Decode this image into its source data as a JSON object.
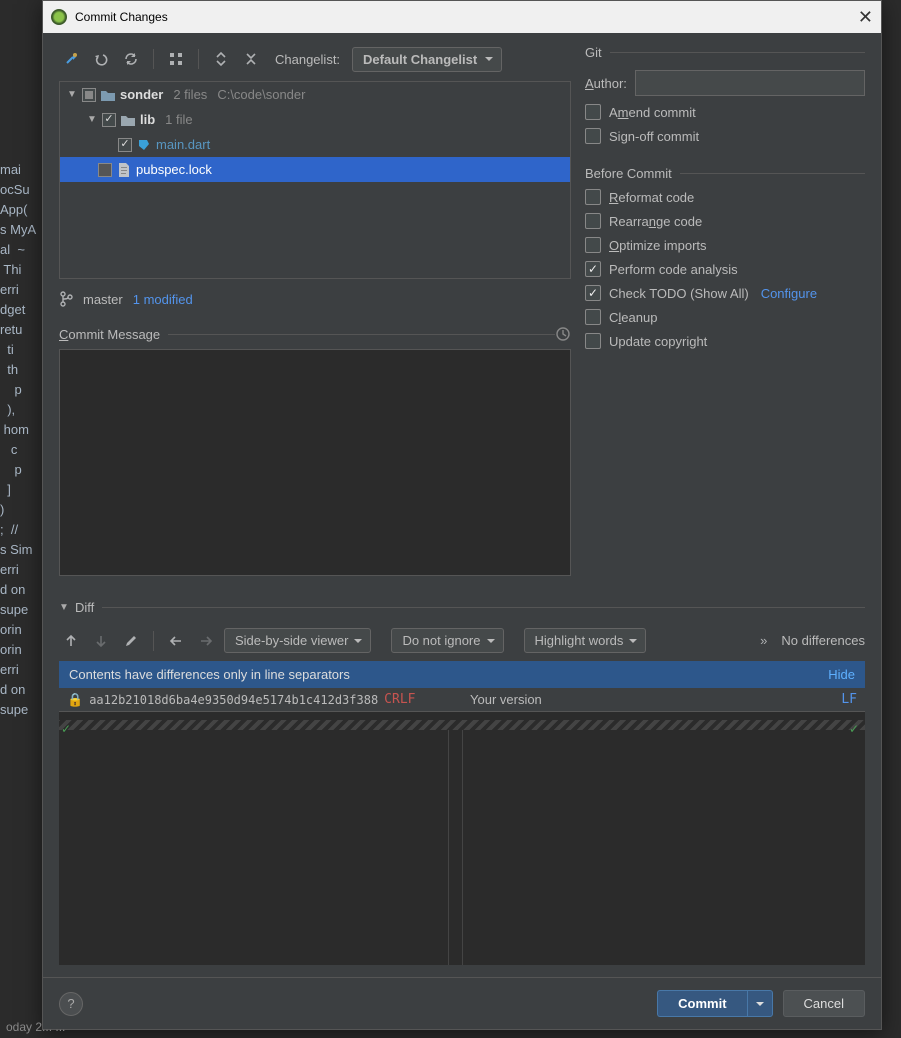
{
  "bg_editor_lines": [
    "mai",
    "ocSu",
    "App(",
    "",
    "",
    "s MyA",
    "al  ~",
    " Thi",
    "erri",
    "dget",
    "retu",
    "  ti",
    "  th",
    "    p",
    "  ),",
    " hom",
    "   c",
    "    p",
    "",
    "",
    "  ]",
    ")",
    ";  //",
    "",
    "",
    "",
    "s Sim",
    "erri",
    "d on",
    "supe",
    "orin",
    "orin",
    "",
    "",
    "erri",
    "d on",
    "supe"
  ],
  "titlebar": {
    "title": "Commit Changes"
  },
  "toolbar": {
    "changelist_label": "Changelist:",
    "changelist_value": "Default Changelist"
  },
  "tree": {
    "root": {
      "name": "sonder",
      "meta_files": "2 files",
      "path": "C:\\code\\sonder"
    },
    "lib": {
      "name": "lib",
      "meta": "1 file"
    },
    "main": {
      "name": "main.dart"
    },
    "pubspec": {
      "name": "pubspec.lock"
    }
  },
  "status": {
    "branch": "master",
    "modified": "1 modified"
  },
  "commit_msg_label": "Commit Message",
  "git": {
    "header": "Git",
    "author_label": "Author:",
    "amend": "Amend commit",
    "signoff": "Sign-off commit"
  },
  "before": {
    "header": "Before Commit",
    "reformat": "Reformat code",
    "rearrange": "Rearrange code",
    "optimize": "Optimize imports",
    "analysis": "Perform code analysis",
    "todo": "Check TODO (Show All)",
    "configure": "Configure",
    "cleanup": "Cleanup",
    "copyright": "Update copyright"
  },
  "diff": {
    "label": "Diff",
    "viewer": "Side-by-side viewer",
    "ignore": "Do not ignore",
    "highlight": "Highlight words",
    "no_diff": "No differences",
    "sep_msg": "Contents have differences only in line separators",
    "hide": "Hide",
    "hash": "aa12b21018d6ba4e9350d94e5174b1c412d3f388",
    "crlf": "CRLF",
    "your": "Your version",
    "lf": "LF"
  },
  "footer": {
    "commit": "Commit",
    "cancel": "Cancel"
  },
  "bottom_strip": "oday 2...  ..."
}
